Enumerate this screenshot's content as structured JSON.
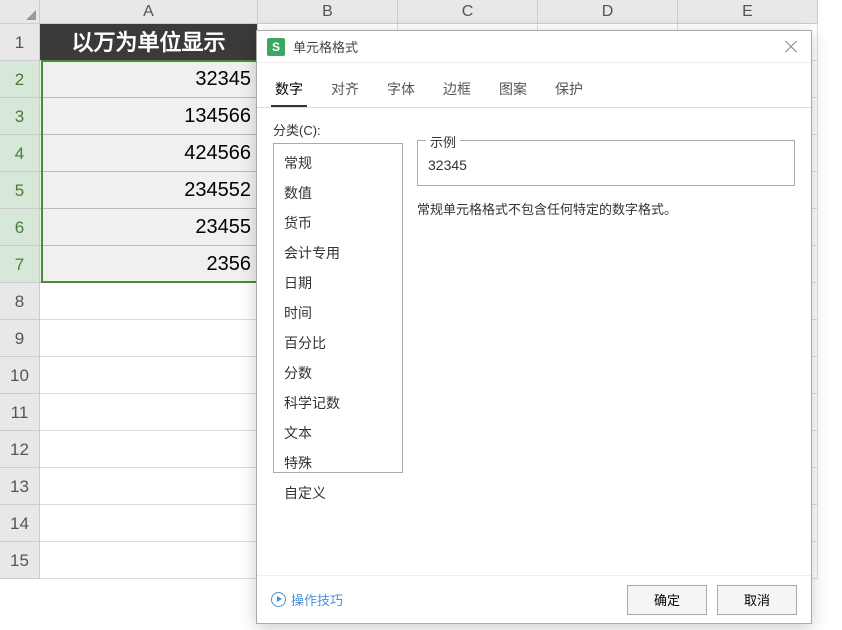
{
  "spreadsheet": {
    "column_headers": [
      "A",
      "B",
      "C",
      "D",
      "E"
    ],
    "row_headers": [
      1,
      2,
      3,
      4,
      5,
      6,
      7,
      8,
      9,
      10,
      11,
      12,
      13,
      14,
      15
    ],
    "header_cell": "以万为单位显示",
    "data_cells": [
      "32345",
      "134566",
      "424566",
      "234552",
      "23455",
      "2356"
    ]
  },
  "dialog": {
    "title": "单元格格式",
    "tabs": [
      "数字",
      "对齐",
      "字体",
      "边框",
      "图案",
      "保护"
    ],
    "category_label": "分类(C):",
    "categories": [
      "常规",
      "数值",
      "货币",
      "会计专用",
      "日期",
      "时间",
      "百分比",
      "分数",
      "科学记数",
      "文本",
      "特殊",
      "自定义"
    ],
    "example_label": "示例",
    "example_value": "32345",
    "description": "常规单元格格式不包含任何特定的数字格式。",
    "tips_link": "操作技巧",
    "ok_button": "确定",
    "cancel_button": "取消"
  }
}
